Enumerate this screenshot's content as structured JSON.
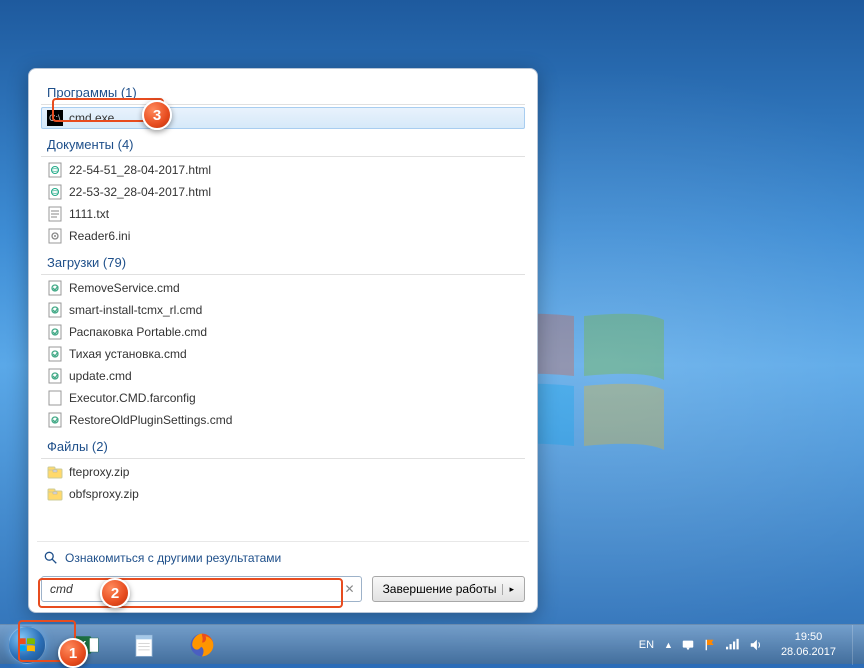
{
  "sections": [
    {
      "header": "Программы (1)",
      "key": "programs",
      "items": [
        {
          "label": "cmd.exe",
          "icon": "cmd",
          "selected": true
        }
      ]
    },
    {
      "header": "Документы (4)",
      "key": "documents",
      "items": [
        {
          "label": "22-54-51_28-04-2017.html",
          "icon": "html"
        },
        {
          "label": "22-53-32_28-04-2017.html",
          "icon": "html"
        },
        {
          "label": "1111.txt",
          "icon": "txt"
        },
        {
          "label": "Reader6.ini",
          "icon": "ini"
        }
      ]
    },
    {
      "header": "Загрузки (79)",
      "key": "downloads",
      "items": [
        {
          "label": "RemoveService.cmd",
          "icon": "cmd-file"
        },
        {
          "label": "smart-install-tcmx_rl.cmd",
          "icon": "cmd-file"
        },
        {
          "label": "Распаковка Portable.cmd",
          "icon": "cmd-file"
        },
        {
          "label": "Тихая установка.cmd",
          "icon": "cmd-file"
        },
        {
          "label": "update.cmd",
          "icon": "cmd-file"
        },
        {
          "label": "Executor.CMD.farconfig",
          "icon": "file"
        },
        {
          "label": "RestoreOldPluginSettings.cmd",
          "icon": "cmd-file"
        }
      ]
    },
    {
      "header": "Файлы (2)",
      "key": "files",
      "items": [
        {
          "label": "fteproxy.zip",
          "icon": "zip"
        },
        {
          "label": "obfsproxy.zip",
          "icon": "zip"
        }
      ]
    }
  ],
  "more_results_label": "Ознакомиться с другими результатами",
  "search_value": "cmd",
  "shutdown_label": "Завершение работы",
  "systray": {
    "lang": "EN",
    "time": "19:50",
    "date": "28.06.2017"
  },
  "callouts": {
    "c1": "1",
    "c2": "2",
    "c3": "3"
  }
}
